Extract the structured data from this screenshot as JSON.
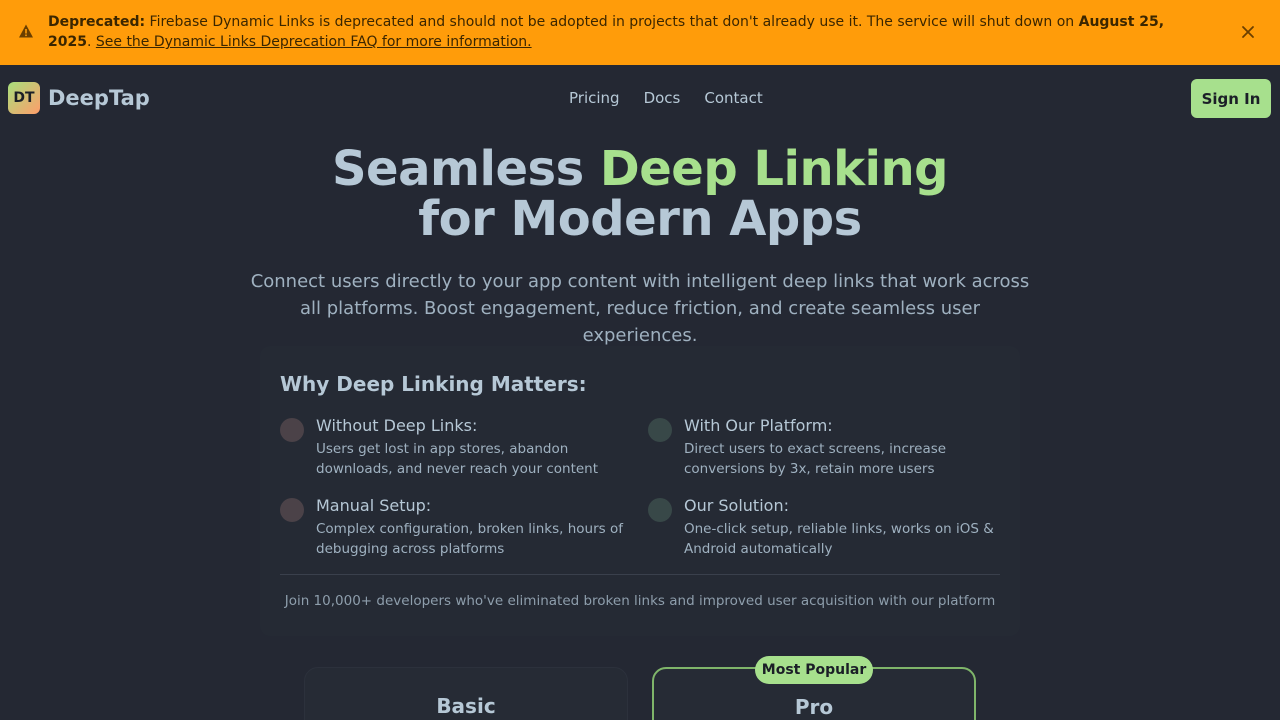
{
  "banner": {
    "label": "Deprecated:",
    "text_before": " Firebase Dynamic Links is deprecated and should not be adopted in projects that don't already use it. The service will shut down on ",
    "date": "August 25, 2025",
    "text_after": ". ",
    "link": "See the Dynamic Links Deprecation FAQ for more information.",
    "warning_icon": "warning-triangle-icon",
    "close_icon": "close-icon",
    "color": "#ff9c0a"
  },
  "header": {
    "logo": "DT",
    "brand": "DeepTap",
    "nav": [
      "Pricing",
      "Docs",
      "Contact"
    ],
    "signin_label": "Sign In"
  },
  "hero": {
    "title_part1": "Seamless ",
    "title_accent": "Deep Linking",
    "title_part2": "for Modern Apps",
    "subtitle": "Connect users directly to your app content with intelligent deep links that work across all platforms. Boost engagement, reduce friction, and create seamless user experiences.",
    "accent_color": "#a7e08d"
  },
  "why": {
    "title": "Why Deep Linking Matters:",
    "points": [
      {
        "title": "Without Deep Links:",
        "desc": "Users get lost in app stores, abandon downloads, and never reach your content"
      },
      {
        "title": "With Our Platform:",
        "desc": "Direct users to exact screens, increase conversions by 3x, retain more users"
      },
      {
        "title": "Manual Setup:",
        "desc": "Complex configuration, broken links, hours of debugging across platforms"
      },
      {
        "title": "Our Solution:",
        "desc": "One-click setup, reliable links, works on iOS & Android automatically"
      }
    ],
    "footer": "Join 10,000+ developers who've eliminated broken links and improved user acquisition with our platform"
  },
  "pricing": {
    "badge": "Most Popular",
    "plans": [
      {
        "name": "Basic"
      },
      {
        "name": "Pro"
      }
    ]
  }
}
